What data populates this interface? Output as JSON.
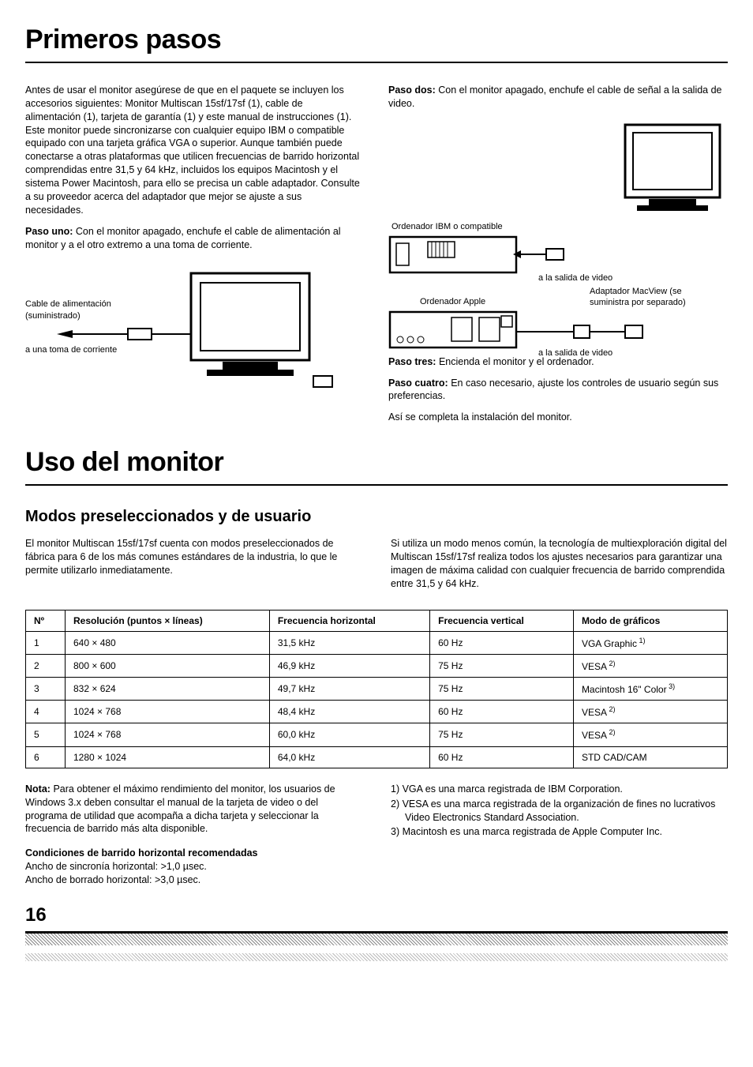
{
  "section1": {
    "title": "Primeros pasos",
    "intro": "Antes de usar el monitor asegúrese de que en el paquete se incluyen los accesorios siguientes: Monitor Multiscan 15sf/17sf (1), cable de alimentación (1), tarjeta de garantía (1) y este manual de instrucciones (1).\nEste monitor puede sincronizarse con cualquier equipo IBM o compatible equipado con una tarjeta gráfica VGA o superior. Aunque también puede conectarse a otras plataformas que utilicen frecuencias de barrido horizontal comprendidas entre 31,5 y 64 kHz, incluidos los equipos Macintosh y el sistema Power Macintosh, para ello se precisa un cable adaptador. Consulte a su proveedor acerca del adaptador que mejor se ajuste a sus necesidades.",
    "step1_label": "Paso uno:",
    "step1_body": "Con el monitor apagado, enchufe el cable de alimentación al monitor y a el otro extremo a una toma de corriente.",
    "diag1_label1": "Cable de alimentación (suministrado)",
    "diag1_label2": "a una toma de corriente",
    "step2_label": "Paso dos:",
    "step2_body": "Con el monitor apagado, enchufe el cable de señal a la salida de video.",
    "diag2_label_ibm": "Ordenador IBM o compatible",
    "diag2_label_apple": "Ordenador Apple",
    "diag2_label_macview": "Adaptador MacView (se suministra por separado)",
    "diag2_label_video1": "a la salida de video",
    "diag2_label_video2": "a la salida de video",
    "step3_label": "Paso tres:",
    "step3_body": "Encienda el monitor y el ordenador.",
    "step4_label": "Paso cuatro:",
    "step4_body": "En caso necesario, ajuste los controles de usuario según sus preferencias.",
    "closing": "Así se completa la instalación del monitor."
  },
  "section2": {
    "title": "Uso del monitor",
    "subheading": "Modos preseleccionados y de usuario",
    "para_left": "El monitor Multiscan 15sf/17sf cuenta con modos preseleccionados de fábrica para 6 de los más comunes estándares de la industria, lo que le permite utilizarlo inmediatamente.",
    "para_right": "Si utiliza un modo menos común, la tecnología de multiexploración digital del Multiscan 15sf/17sf realiza todos los ajustes necesarios para garantizar una imagen de máxima calidad con cualquier frecuencia de barrido comprendida entre 31,5 y 64 kHz.",
    "table": {
      "headers": [
        "Nº",
        "Resolución (puntos × líneas)",
        "Frecuencia horizontal",
        "Frecuencia vertical",
        "Modo de gráficos"
      ],
      "rows": [
        [
          "1",
          "640 × 480",
          "31,5 kHz",
          "60 Hz",
          "VGA Graphic",
          "1)"
        ],
        [
          "2",
          "800 × 600",
          "46,9 kHz",
          "75 Hz",
          "VESA",
          "2)"
        ],
        [
          "3",
          "832 × 624",
          "49,7 kHz",
          "75 Hz",
          "Macintosh 16\" Color",
          "3)"
        ],
        [
          "4",
          "1024 × 768",
          "48,4 kHz",
          "60 Hz",
          "VESA",
          "2)"
        ],
        [
          "5",
          "1024 × 768",
          "60,0 kHz",
          "75 Hz",
          "VESA",
          "2)"
        ],
        [
          "6",
          "1280 × 1024",
          "64,0 kHz",
          "60 Hz",
          "STD CAD/CAM",
          ""
        ]
      ]
    },
    "nota_label": "Nota:",
    "nota_body": "Para obtener el máximo rendimiento del monitor, los usuarios de Windows 3.x deben consultar el manual de la tarjeta de video o del programa de utilidad que acompaña a dicha tarjeta y seleccionar la frecuencia de barrido más alta disponible.",
    "cond_heading": "Condiciones de barrido horizontal recomendadas",
    "cond_line1": "Ancho de sincronía horizontal: >1,0 µsec.",
    "cond_line2": "Ancho de borrado horizontal: >3,0 µsec.",
    "foot1": "1) VGA es una marca registrada de IBM Corporation.",
    "foot2": "2) VESA es una marca registrada de la organización de fines no lucrativos Video Electronics Standard Association.",
    "foot3": "3) Macintosh es una marca registrada de Apple Computer Inc."
  },
  "page_number": "16"
}
